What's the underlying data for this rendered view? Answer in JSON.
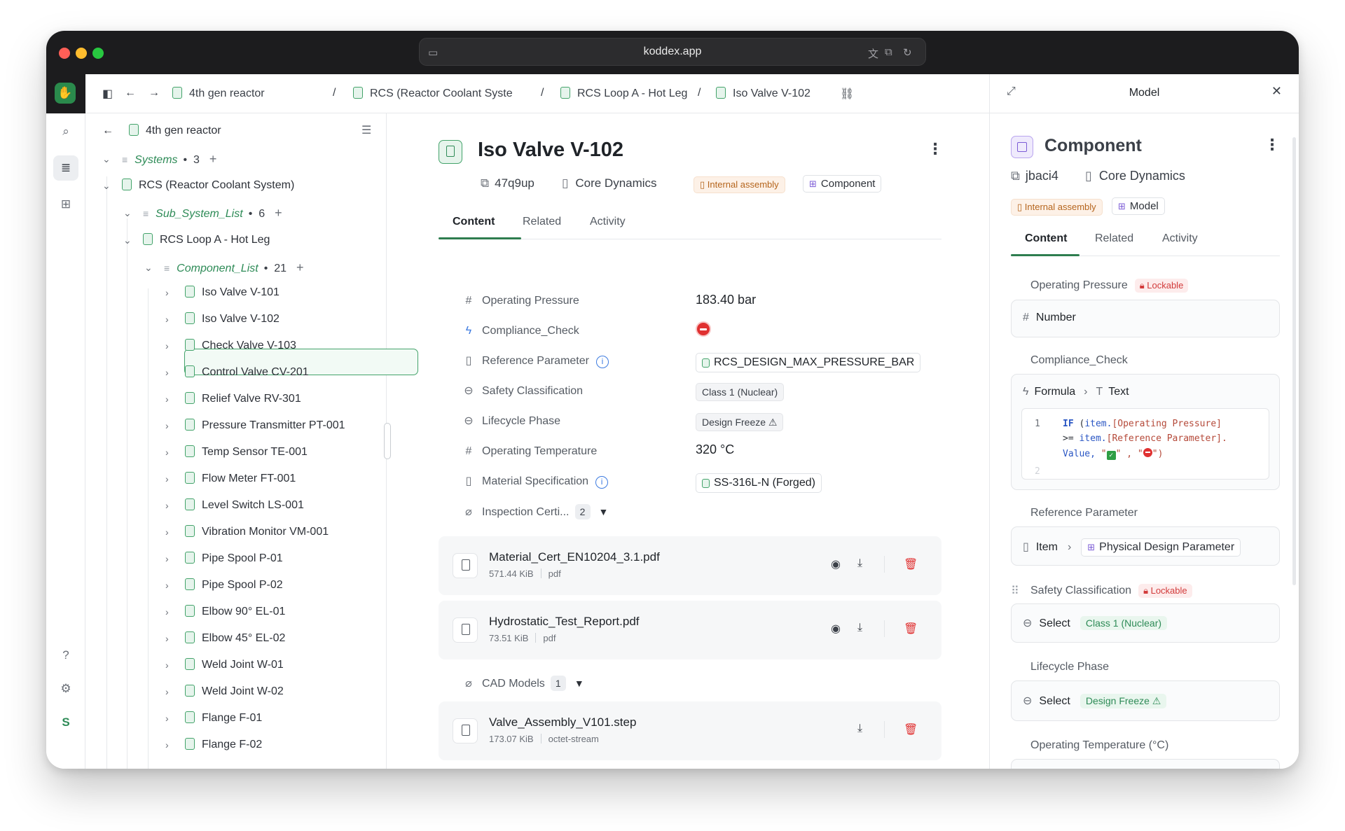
{
  "browser": {
    "url": "koddex.app"
  },
  "breadcrumb": {
    "items": [
      "4th gen reactor",
      "RCS (Reactor Coolant Syste",
      "RCS Loop A - Hot Leg",
      "Iso Valve V-102"
    ],
    "separator": "/"
  },
  "tree": {
    "root": "4th gen reactor",
    "systems_label": "Systems",
    "systems_count": "3",
    "rcs": "RCS (Reactor Coolant System)",
    "sub_system_label": "Sub_System_List",
    "sub_system_count": "6",
    "loop": "RCS Loop A - Hot Leg",
    "component_label": "Component_List",
    "component_count": "21",
    "bullet": "•",
    "components": [
      "Iso Valve V-101",
      "Iso Valve V-102",
      "Check Valve V-103",
      "Control Valve CV-201",
      "Relief Valve RV-301",
      "Pressure Transmitter PT-001",
      "Temp Sensor TE-001",
      "Flow Meter FT-001",
      "Level Switch LS-001",
      "Vibration Monitor VM-001",
      "Pipe Spool P-01",
      "Pipe Spool P-02",
      "Elbow 90° EL-01",
      "Elbow 45° EL-02",
      "Weld Joint W-01",
      "Weld Joint W-02",
      "Flange F-01",
      "Flange F-02"
    ]
  },
  "main": {
    "title": "Iso Valve V-102",
    "id": "47q9up",
    "org": "Core Dynamics",
    "tag": "Internal assembly",
    "model": "Component",
    "tabs": [
      "Content",
      "Related",
      "Activity"
    ],
    "props": {
      "operating_pressure": {
        "label": "Operating Pressure",
        "value": "183.40 bar"
      },
      "compliance_check": {
        "label": "Compliance_Check"
      },
      "reference_parameter": {
        "label": "Reference Parameter",
        "value": "RCS_DESIGN_MAX_PRESSURE_BAR"
      },
      "safety_classification": {
        "label": "Safety Classification",
        "value": "Class 1 (Nuclear)"
      },
      "lifecycle_phase": {
        "label": "Lifecycle Phase",
        "value": "Design Freeze ⚠"
      },
      "operating_temperature": {
        "label": "Operating Temperature",
        "value": "320 °C"
      },
      "material_specification": {
        "label": "Material Specification",
        "value": "SS-316L-N (Forged)"
      },
      "inspection": {
        "label": "Inspection Certi...",
        "count": "2"
      },
      "cad": {
        "label": "CAD Models",
        "count": "1"
      }
    },
    "files": [
      {
        "name": "Material_Cert_EN10204_3.1.pdf",
        "size": "571.44 KiB",
        "type": "pdf"
      },
      {
        "name": "Hydrostatic_Test_Report.pdf",
        "size": "73.51 KiB",
        "type": "pdf"
      },
      {
        "name": "Valve_Assembly_V101.step",
        "size": "173.07 KiB",
        "type": "octet-stream"
      }
    ]
  },
  "panel": {
    "title": "Model",
    "heading": "Component",
    "id": "jbaci4",
    "org": "Core Dynamics",
    "tag": "Internal assembly",
    "model": "Model",
    "tabs": [
      "Content",
      "Related",
      "Activity"
    ],
    "lockable": "Lockable",
    "fields": {
      "operating_pressure": {
        "label": "Operating Pressure",
        "type": "Number"
      },
      "compliance_check": {
        "label": "Compliance_Check",
        "type": "Formula",
        "subtype": "Text"
      },
      "reference_parameter": {
        "label": "Reference Parameter",
        "type": "Item",
        "target": "Physical Design Parameter"
      },
      "safety_classification": {
        "label": "Safety Classification",
        "type": "Select",
        "value": "Class 1 (Nuclear)"
      },
      "lifecycle_phase": {
        "label": "Lifecycle Phase",
        "type": "Select",
        "value": "Design Freeze ⚠"
      },
      "operating_temperature": {
        "label": "Operating Temperature (°C)"
      }
    },
    "code": {
      "line1_no": "1",
      "line2_no": "2",
      "kw_if": "IF",
      "item1": "item.",
      "ref1": "[Operating Pressure]",
      "op": ">=",
      "item2": "item.",
      "ref2": "[Reference Parameter].",
      "value": "Value,",
      "q1": "\"",
      "q2": "\" , \"",
      "q3": "\")"
    }
  },
  "colors": {
    "accent_green": "#2e7d4f",
    "danger": "#e03131",
    "purple": "#7c5cd6",
    "orange": "#b5651d"
  }
}
